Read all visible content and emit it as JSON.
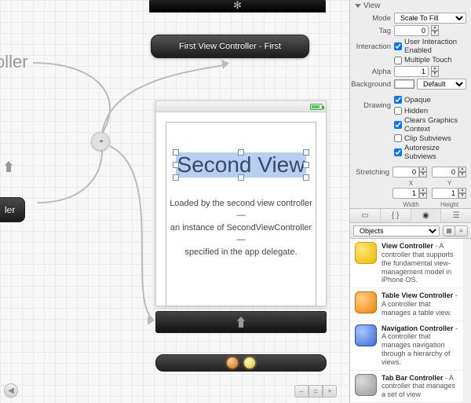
{
  "canvas": {
    "first_vc_title": "First View Controller - First",
    "oller_label": "oller",
    "ler_label": "ler",
    "second_heading": "Second View",
    "second_desc_l1": "Loaded by the second view controller —",
    "second_desc_l2": "an instance of SecondViewController —",
    "second_desc_l3": "specified in the app delegate."
  },
  "inspector": {
    "section": "View",
    "mode_label": "Mode",
    "mode_value": "Scale To Fill",
    "tag_label": "Tag",
    "tag_value": "0",
    "interaction_label": "Interaction",
    "user_interaction": "User Interaction Enabled",
    "multiple_touch": "Multiple Touch",
    "alpha_label": "Alpha",
    "alpha_value": "1",
    "background_label": "Background",
    "background_value": "Default",
    "drawing_label": "Drawing",
    "opaque": "Opaque",
    "hidden": "Hidden",
    "clears_gc": "Clears Graphics Context",
    "clip_subviews": "Clip Subviews",
    "autoresize": "Autoresize Subviews",
    "stretching_label": "Stretching",
    "x_val": "0",
    "y_val": "0",
    "x_label": "X",
    "y_label": "Y",
    "w_val": "1",
    "h_val": "1",
    "w_label": "Width",
    "h_label": "Height"
  },
  "library": {
    "filter": "Objects",
    "items": [
      {
        "title": "View Controller",
        "desc": " - A controller that supports the fundamental view-management model in iPhone OS."
      },
      {
        "title": "Table View Controller",
        "desc": " - A controller that manages a table view."
      },
      {
        "title": "Navigation Controller",
        "desc": " - A controller that manages navigation through a hierarchy of views."
      },
      {
        "title": "Tab Bar Controller",
        "desc": " - A controller that manages a set of view"
      }
    ]
  }
}
